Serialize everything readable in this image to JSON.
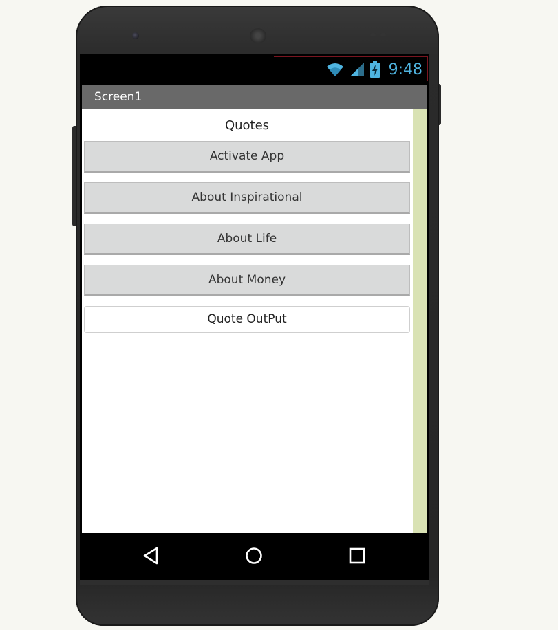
{
  "status_bar": {
    "time": "9:48",
    "icons": [
      "wifi-icon",
      "cell-signal-icon",
      "battery-charging-icon"
    ],
    "icon_color": "#4fb4e0"
  },
  "app_bar": {
    "title": "Screen1",
    "background": "#696969"
  },
  "main": {
    "heading": "Quotes",
    "buttons": [
      {
        "label": "Activate App"
      },
      {
        "label": "About Inspirational"
      },
      {
        "label": "About Life"
      },
      {
        "label": "About Money"
      }
    ],
    "output_label": "Quote OutPut"
  },
  "nav_bar": {
    "icons": [
      "back-icon",
      "home-icon",
      "recents-icon"
    ]
  },
  "colors": {
    "button_bg": "#d9dada",
    "scroll_strip": "#d9e2b4",
    "page_bg": "#f7f7f2"
  }
}
